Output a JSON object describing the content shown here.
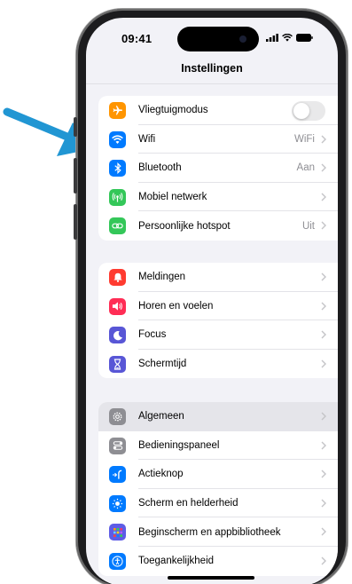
{
  "status_bar": {
    "time": "09:41"
  },
  "nav": {
    "title": "Instellingen"
  },
  "groups": [
    {
      "rows": [
        {
          "label": "Vliegtuigmodus",
          "icon": "airplane-icon",
          "color": "#FF9500",
          "control": "toggle",
          "toggle_on": false
        },
        {
          "label": "Wifi",
          "icon": "wifi-icon",
          "color": "#007AFF",
          "value": "WiFi"
        },
        {
          "label": "Bluetooth",
          "icon": "bluetooth-icon",
          "color": "#007AFF",
          "value": "Aan"
        },
        {
          "label": "Mobiel netwerk",
          "icon": "antenna-icon",
          "color": "#34C759",
          "value": ""
        },
        {
          "label": "Persoonlijke hotspot",
          "icon": "hotspot-icon",
          "color": "#34C759",
          "value": "Uit"
        }
      ]
    },
    {
      "rows": [
        {
          "label": "Meldingen",
          "icon": "bell-icon",
          "color": "#FF3B30"
        },
        {
          "label": "Horen en voelen",
          "icon": "speaker-icon",
          "color": "#FF2D55"
        },
        {
          "label": "Focus",
          "icon": "moon-icon",
          "color": "#5856D6"
        },
        {
          "label": "Schermtijd",
          "icon": "hourglass-icon",
          "color": "#5856D6"
        }
      ]
    },
    {
      "rows": [
        {
          "label": "Algemeen",
          "icon": "gear-icon",
          "color": "#8E8E93",
          "highlighted": true
        },
        {
          "label": "Bedieningspaneel",
          "icon": "sliders-icon",
          "color": "#8E8E93"
        },
        {
          "label": "Actieknop",
          "icon": "action-button-icon",
          "color": "#007AFF"
        },
        {
          "label": "Scherm en helderheid",
          "icon": "sun-icon",
          "color": "#007AFF"
        },
        {
          "label": "Beginscherm en appbibliotheek",
          "icon": "app-grid-icon",
          "color": "#5E5CE6"
        },
        {
          "label": "Toegankelijkheid",
          "icon": "accessibility-icon",
          "color": "#007AFF"
        }
      ]
    }
  ],
  "annotation": {
    "arrow_color": "#2196D3",
    "points_to": "Wifi"
  }
}
